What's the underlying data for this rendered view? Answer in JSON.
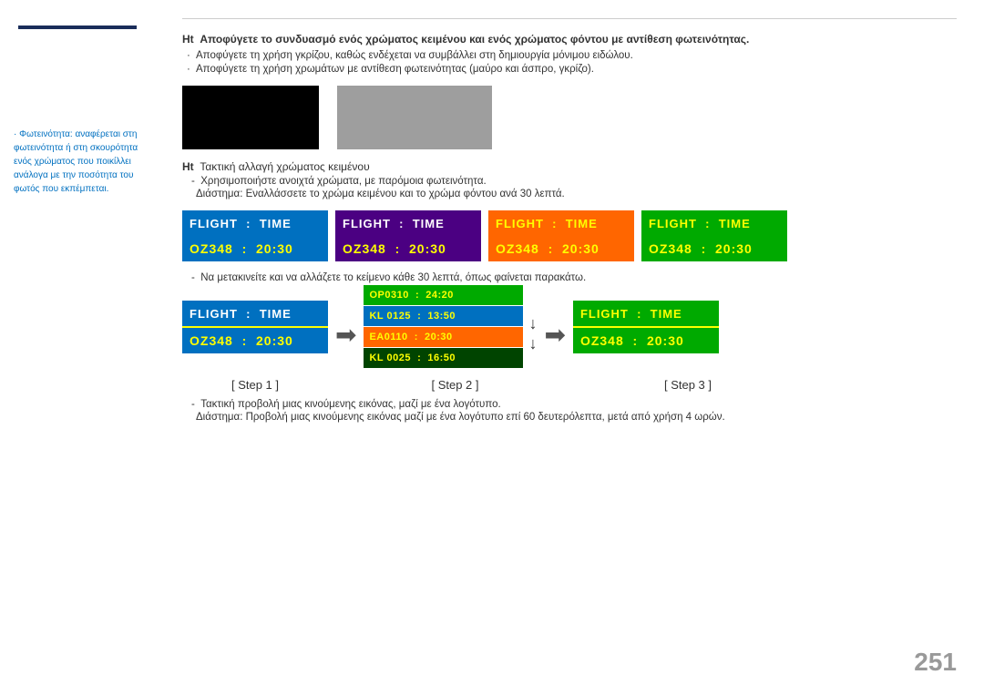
{
  "sidebar": {
    "note_text": "Φωτεινότητα: αναφέρεται στη φωτεινότητα ή στη σκουρότητα ενός χρώματος που ποικίλλει ανάλογα με την ποσότητα του φωτός που εκπέμπεται."
  },
  "header": {
    "hint1": {
      "label": "Ht",
      "text": "Αποφύγετε το συνδυασμό ενός χρώματος κειμένου και ενός χρώματος φόντου με αντίθεση φωτεινότητας."
    },
    "bullet1": "Αποφύγετε τη χρήση γκρίζου, καθώς ενδέχεται να συμβάλλει στη δημιουργία μόνιμου ειδώλου.",
    "bullet2": "Αποφύγετε τη χρήση χρωμάτων με αντίθεση φωτεινότητας (μαύρο και άσπρο, γκρίζο)."
  },
  "sub_hint": {
    "label": "Ht",
    "title": "Τακτική αλλαγή χρώματος κειμένου",
    "dash1": "Χρησιμοποιήστε ανοιχτά χρώματα, με παρόμοια φωτεινότητα.",
    "dash2": "Διάστημα: Εναλλάσσετε το χρώμα κειμένου και το χρώμα φόντου ανά 30 λεπτά."
  },
  "cards": [
    {
      "id": "card1",
      "top": {
        "left": "FLIGHT",
        "sep": ":",
        "right": "TIME",
        "bg": "#0070c0",
        "color": "#ffffff"
      },
      "bottom": {
        "left": "OZ348",
        "sep": ":",
        "right": "20:30",
        "bg": "#0070c0",
        "color": "#ffff00"
      },
      "outer_bg": "#ffff00"
    },
    {
      "id": "card2",
      "top": {
        "left": "FLIGHT",
        "sep": ":",
        "right": "TIME",
        "bg": "#4b0082",
        "color": "#ffffff"
      },
      "bottom": {
        "left": "OZ348",
        "sep": ":",
        "right": "20:30",
        "bg": "#4b0082",
        "color": "#ffff00"
      },
      "outer_bg": "#ffff00"
    },
    {
      "id": "card3",
      "top": {
        "left": "FLIGHT",
        "sep": ":",
        "right": "TIME",
        "bg": "#ff6600",
        "color": "#ffff00"
      },
      "bottom": {
        "left": "OZ348",
        "sep": ":",
        "right": "20:30",
        "bg": "#ff6600",
        "color": "#ffff00"
      },
      "outer_bg": "#ffff00"
    },
    {
      "id": "card4",
      "top": {
        "left": "FLIGHT",
        "sep": ":",
        "right": "TIME",
        "bg": "#00aa00",
        "color": "#ffff00"
      },
      "bottom": {
        "left": "OZ348",
        "sep": ":",
        "right": "20:30",
        "bg": "#00aa00",
        "color": "#ffff00"
      },
      "outer_bg": "#ffff00"
    }
  ],
  "move_note": "Να μετακινείτε και να αλλάζετε το κείμενο κάθε 30 λεπτά, όπως φαίνεται παρακάτω.",
  "steps": {
    "step1": {
      "label": "[ Step 1 ]",
      "card": {
        "top": {
          "text": "FLIGHT  :  TIME",
          "bg": "#0070c0",
          "color": "#ffffff"
        },
        "bottom": {
          "text": "OZ348  :  20:30",
          "bg": "#0070c0",
          "color": "#ffff00"
        },
        "outer_bg": "#ffff00"
      }
    },
    "step2": {
      "label": "[ Step 2 ]",
      "rows": [
        {
          "text": "OP0310  :  24:20",
          "bg": "#00aa00",
          "color": "#ffff00"
        },
        {
          "text": "KL 0125  :  13:50",
          "bg": "#0070c0",
          "color": "#ffff00"
        },
        {
          "text": "EA0110  :  20:30",
          "bg": "#ff6600",
          "color": "#ffff00"
        },
        {
          "text": "KL 0025  :  16:50",
          "bg": "#003300",
          "color": "#ffff00"
        }
      ]
    },
    "step3": {
      "label": "[ Step 3 ]",
      "card": {
        "top": {
          "text": "FLIGHT  :  TIME",
          "bg": "#00aa00",
          "color": "#ffff00"
        },
        "bottom": {
          "text": "OZ348  :  20:30",
          "bg": "#00aa00",
          "color": "#ffff00"
        },
        "outer_bg": "#ffff00"
      }
    }
  },
  "bottom_notes": {
    "dash1": "Τακτική προβολή μιας κινούμενης εικόνας, μαζί με ένα λογότυπο.",
    "dash2": "Διάστημα: Προβολή μιας κινούμενης εικόνας μαζί με ένα λογότυπο επί 60 δευτερόλεπτα, μετά από χρήση 4 ωρών."
  },
  "page_number": "251"
}
